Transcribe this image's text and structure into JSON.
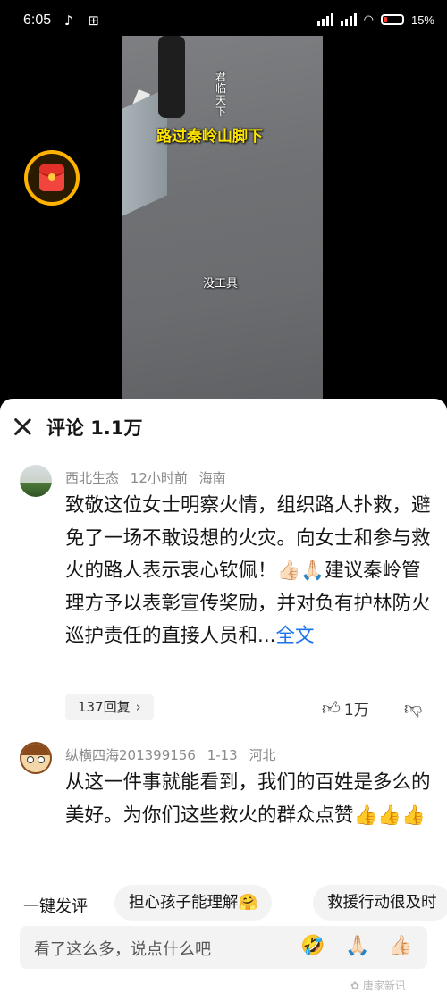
{
  "status_bar": {
    "time": "6:05",
    "app_icons": "♪ ⊞",
    "battery": "15%"
  },
  "video": {
    "caption_main": "路过秦岭山脚下",
    "caption_vertical": "君临天下",
    "caption_sub": "没工具"
  },
  "comments_sheet": {
    "title": "评论 1.1万",
    "comments": [
      {
        "username": "西北生态",
        "time": "12小时前",
        "location": "海南",
        "text_1": "致敬这位女士明察火情，组织路人扑救，避免了一场不敢设想的火灾。向女士和参与救火的路人表示衷心钦佩！",
        "emoji_1": "👍🏻🙏🏻",
        "text_2": "建议秦岭管理方予以表彰宣传奖励，并对负有护林防火巡护责任的直接人员和...",
        "more": "全文",
        "reply_label": "137回复",
        "likes": "1万"
      },
      {
        "username": "纵横四海201399156",
        "time": "1-13",
        "location": "河北",
        "text": "从这一件事就能看到，我们的百姓是多么的美好。为你们这些救火的群众点赞",
        "emoji": "👍👍👍"
      }
    ]
  },
  "quick_reply": {
    "label": "一键发评",
    "chips": [
      "担心孩子能理解🤗",
      "救援行动很及时"
    ]
  },
  "input": {
    "placeholder": "看了这么多，说点什么吧",
    "emojis": [
      "🤣",
      "🙏🏻",
      "👍🏻"
    ]
  },
  "watermark": "✿ 唐家新讯"
}
